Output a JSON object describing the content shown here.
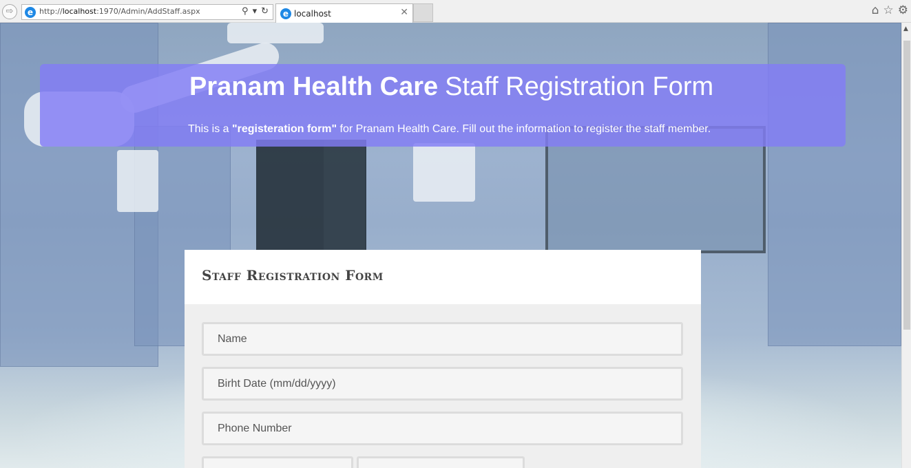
{
  "browser": {
    "url_prefix": "http://",
    "url_host": "localhost",
    "url_rest": ":1970/Admin/AddStaff.aspx",
    "tab_title": "localhost",
    "nav_back_icon": "back-arrow-icon",
    "site_icon": "ie-icon",
    "toolbar_icons": [
      "home-icon",
      "favorites-star-icon",
      "settings-gear-icon"
    ]
  },
  "hero": {
    "title_bold": "Pranam Health Care",
    "title_light": "Staff Registration Form",
    "subtitle_pre": "This is a ",
    "subtitle_bold": "\"registeration form\"",
    "subtitle_post": " for Pranam Health Care. Fill out the information to register the staff member."
  },
  "form": {
    "title": "Staff Registration Form",
    "fields": {
      "name_placeholder": "Name",
      "birthdate_placeholder": "Birht Date (mm/dd/yyyy)",
      "phone_placeholder": "Phone Number"
    }
  },
  "colors": {
    "hero_background": "#827df5",
    "form_background": "#efefef"
  }
}
